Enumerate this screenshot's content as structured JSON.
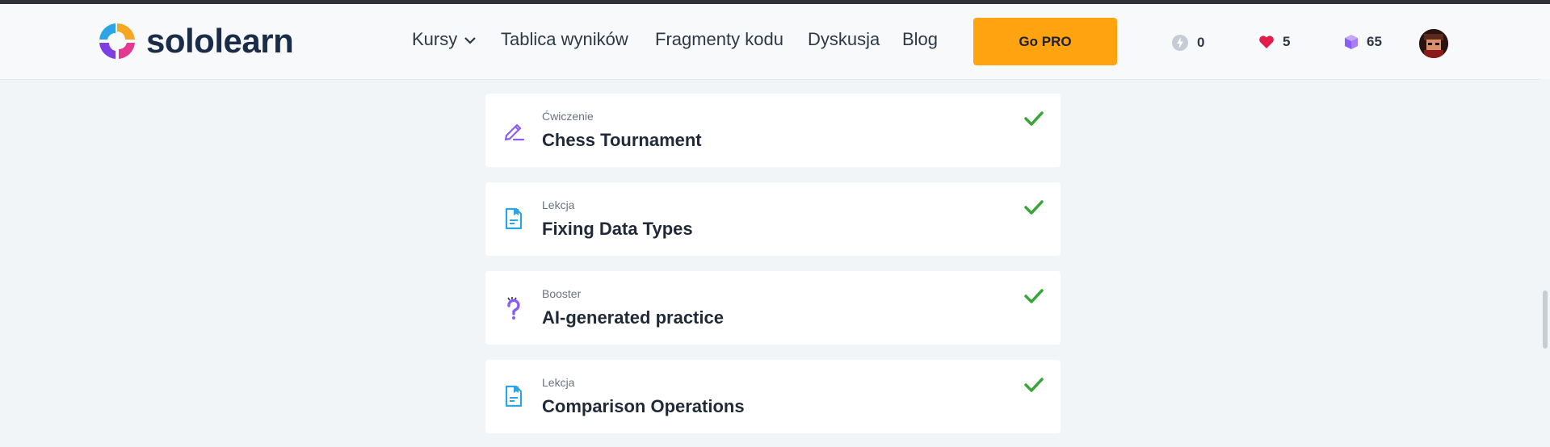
{
  "brand": {
    "name": "sololearn"
  },
  "nav": {
    "items": [
      {
        "label": "Kursy",
        "dropdown": true
      },
      {
        "label": "Tablica wyników"
      },
      {
        "label": "Fragmenty kodu"
      },
      {
        "label": "Dyskusja"
      },
      {
        "label": "Blog"
      }
    ]
  },
  "gopro": {
    "label": "Go PRO"
  },
  "stats": {
    "streak": {
      "icon": "lightning-icon",
      "value": "0"
    },
    "hearts": {
      "icon": "heart-icon",
      "value": "5"
    },
    "bits": {
      "icon": "cube-icon",
      "value": "65"
    }
  },
  "lessons": [
    {
      "type": "Ćwiczenie",
      "title": "Chess Tournament",
      "icon": "exercise-pencil-icon",
      "completed": true
    },
    {
      "type": "Lekcja",
      "title": "Fixing Data Types",
      "icon": "lesson-document-icon",
      "completed": true
    },
    {
      "type": "Booster",
      "title": "AI-generated practice",
      "icon": "booster-question-icon",
      "completed": true
    },
    {
      "type": "Lekcja",
      "title": "Comparison Operations",
      "icon": "lesson-document-icon",
      "completed": true
    }
  ],
  "colors": {
    "accent": "#ffa310",
    "check": "#3aa63a",
    "purple": "#8b5cf6",
    "blue": "#2ba5e6",
    "heart": "#e21d4c"
  }
}
